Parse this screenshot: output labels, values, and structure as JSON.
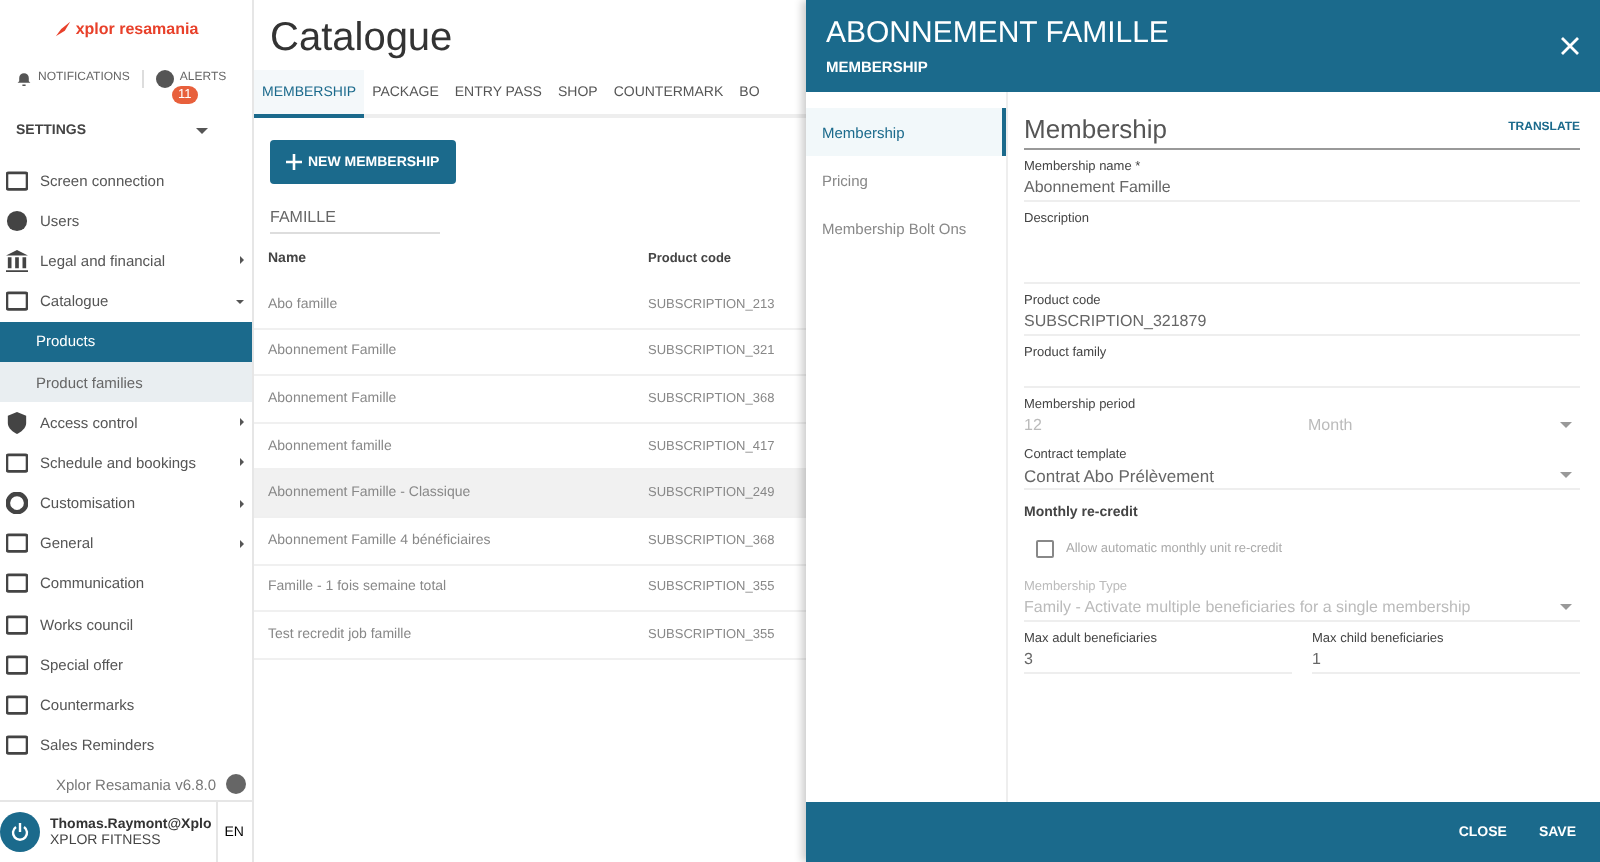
{
  "sidebar": {
    "logo": "xplor resamania",
    "notifications": "NOTIFICATIONS",
    "alerts": "ALERTS",
    "alerts_count": "11",
    "section": "SETTINGS",
    "items": [
      {
        "label": "Screen connection",
        "has_children": false
      },
      {
        "label": "Users",
        "has_children": false
      },
      {
        "label": "Legal and financial",
        "has_children": true,
        "expanded": false
      },
      {
        "label": "Catalogue",
        "has_children": true,
        "expanded": true,
        "children": [
          {
            "label": "Products",
            "selected": true
          },
          {
            "label": "Product families",
            "selected": false
          }
        ]
      },
      {
        "label": "Access control",
        "has_children": true,
        "expanded": false
      },
      {
        "label": "Schedule and bookings",
        "has_children": true,
        "expanded": false
      },
      {
        "label": "Customisation",
        "has_children": true,
        "expanded": false
      },
      {
        "label": "General",
        "has_children": true,
        "expanded": false
      },
      {
        "label": "Communication",
        "has_children": false
      },
      {
        "label": "Works council",
        "has_children": false
      },
      {
        "label": "Special offer",
        "has_children": false
      },
      {
        "label": "Countermarks",
        "has_children": false
      },
      {
        "label": "Sales Reminders",
        "has_children": false
      }
    ],
    "version": "Xplor Resamania v6.8.0",
    "user": "Thomas.Raymont@Xplo",
    "company": "XPLOR FITNESS",
    "language": "EN"
  },
  "main": {
    "title": "Catalogue",
    "tabs": [
      {
        "label": "MEMBERSHIP",
        "selected": true
      },
      {
        "label": "PACKAGE",
        "selected": false
      },
      {
        "label": "ENTRY PASS",
        "selected": false
      },
      {
        "label": "SHOP",
        "selected": false
      },
      {
        "label": "COUNTERMARK",
        "selected": false
      },
      {
        "label": "BO",
        "selected": false
      }
    ],
    "new_button": "NEW MEMBERSHIP",
    "search": "FAMILLE",
    "table": {
      "columns": [
        "Name",
        "Product code"
      ],
      "rows": [
        {
          "cells": [
            "Abo famille",
            "SUBSCRIPTION_213"
          ],
          "hovered": false
        },
        {
          "cells": [
            "Abonnement Famille",
            "SUBSCRIPTION_321"
          ],
          "hovered": false
        },
        {
          "cells": [
            "Abonnement Famille",
            "SUBSCRIPTION_368"
          ],
          "hovered": false
        },
        {
          "cells": [
            "Abonnement famille",
            "SUBSCRIPTION_417"
          ],
          "hovered": false
        },
        {
          "cells": [
            "Abonnement Famille - Classique",
            "SUBSCRIPTION_249"
          ],
          "hovered": true
        },
        {
          "cells": [
            "Abonnement Famille 4 bénéficiaires",
            "SUBSCRIPTION_368"
          ],
          "hovered": false
        },
        {
          "cells": [
            "Famille - 1 fois semaine total",
            "SUBSCRIPTION_355"
          ],
          "hovered": false
        },
        {
          "cells": [
            "Test recredit job famille",
            "SUBSCRIPTION_355"
          ],
          "hovered": false
        }
      ]
    }
  },
  "drawer": {
    "title": "ABONNEMENT FAMILLE",
    "subtitle": "MEMBERSHIP",
    "nav": [
      {
        "label": "Membership",
        "selected": true
      },
      {
        "label": "Pricing",
        "selected": false
      },
      {
        "label": "Membership Bolt Ons",
        "selected": false
      }
    ],
    "section_title": "Membership",
    "translate": "TRANSLATE",
    "fields": [
      {
        "kind": "text",
        "label": "Membership name *",
        "value": "Abonnement Famille",
        "disabled": false
      },
      {
        "kind": "textarea",
        "label": "Description"
      },
      {
        "kind": "text",
        "label": "Product code",
        "value": "SUBSCRIPTION_321879",
        "disabled": false
      },
      {
        "kind": "text",
        "label": "Product family"
      },
      {
        "kind": "period",
        "label": "Membership period",
        "value": "12",
        "unit": "Month",
        "disabled": true
      },
      {
        "kind": "select",
        "label": "Contract template",
        "value": "Contrat Abo Prélèvement",
        "disabled": false
      },
      {
        "kind": "heading",
        "label": "Monthly re-credit"
      },
      {
        "kind": "checkbox",
        "label": "Allow automatic monthly unit re-credit",
        "checked": false
      },
      {
        "kind": "select",
        "label": "Membership Type",
        "value": "Family - Activate multiple beneficiaries for a single membership",
        "disabled": true
      },
      {
        "kind": "pair",
        "label": "Max adult beneficiaries",
        "value": "3",
        "label2": "Max child beneficiaries",
        "value2": "1"
      }
    ],
    "buttons": [
      "CLOSE",
      "SAVE"
    ]
  }
}
